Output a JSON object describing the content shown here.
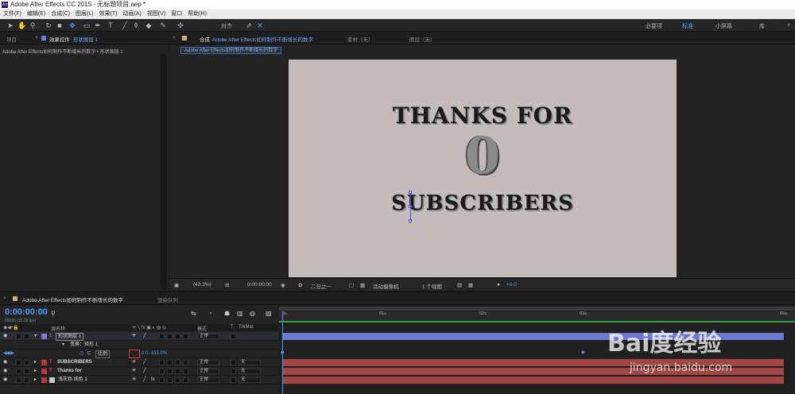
{
  "window": {
    "title": "Adobe After Effects CC 2015 - 无标题项目.aep *",
    "logo": "Ae"
  },
  "menu": [
    "文件(F)",
    "编辑(E)",
    "合成(C)",
    "图层(L)",
    "效果(T)",
    "动画(A)",
    "视图(V)",
    "窗口",
    "帮助(H)"
  ],
  "toolbar": {
    "snap_label": "对齐",
    "workspaces": [
      "必要项",
      "标准",
      "小屏幕",
      "库"
    ],
    "active_workspace": "标准",
    "menu_icon": "»"
  },
  "left_panel": {
    "tabs": [
      "项目",
      "效果控件",
      "形状图层 1"
    ],
    "path": "Adobe After Effects如何制作不断增长的数字 • 形状图层 1"
  },
  "comp_panel": {
    "tabs": {
      "comp_prefix": "合成",
      "comp_name": "Adobe After Effects如何制作不断增长的数字",
      "footage": "素材（无）",
      "layer": "图层（无）"
    },
    "subtab": "Adobe After Effects如何制作不断增长的数字",
    "stage": {
      "line1": "THANKS FOR",
      "counter": "0",
      "line2": "SUBSCRIBERS",
      "bg_color": "#c4bbbc"
    },
    "viewbar": {
      "zoom": "(43.3%)",
      "timecode": "0:00:00:00",
      "resolution": "二分之一",
      "camera": "活动摄像机",
      "views": "1 个视图",
      "exposure": "+0.0"
    }
  },
  "timeline": {
    "tabs": [
      "Adobe After Effects如何制作不断增长的数字",
      "渲染队列"
    ],
    "timecode": "0:00:00:00",
    "fps": "00000 (25.00 fps)",
    "columns": {
      "name": "源名称",
      "mode": "模式",
      "t": "T",
      "trkmat": "TrkMat"
    },
    "layers": [
      {
        "num": "1",
        "name": "形状图层 1",
        "mode": "正常",
        "trkmat": "",
        "color": "#6f7fd6",
        "bar": "#6c79d0"
      },
      {
        "num": "",
        "name": "变换：矩形 1",
        "mode": "",
        "trkmat": "",
        "color": "",
        "bar": ""
      },
      {
        "num": "",
        "name": "比例",
        "value": "0.0, 103.0%",
        "mode": "",
        "trkmat": "",
        "color": "",
        "bar": ""
      },
      {
        "num": "2",
        "name": "SUBSCRIBERS",
        "mode": "正常",
        "trkmat": "无",
        "color": "#b23a3a",
        "bar": "#a14545"
      },
      {
        "num": "3",
        "name": "Thanks for",
        "mode": "正常",
        "trkmat": "无",
        "color": "#b23a3a",
        "bar": "#a14545"
      },
      {
        "num": "4",
        "name": "浅灰色 纯色 1",
        "mode": "正常",
        "trkmat": "无",
        "color": "#c9c9c9",
        "bar": "#a14545"
      }
    ],
    "ruler": [
      "0s",
      "01s",
      "02s",
      "03s",
      "05s"
    ]
  },
  "watermark": {
    "logo": "Bai度经验",
    "url": "jingyan.baidu.com"
  }
}
